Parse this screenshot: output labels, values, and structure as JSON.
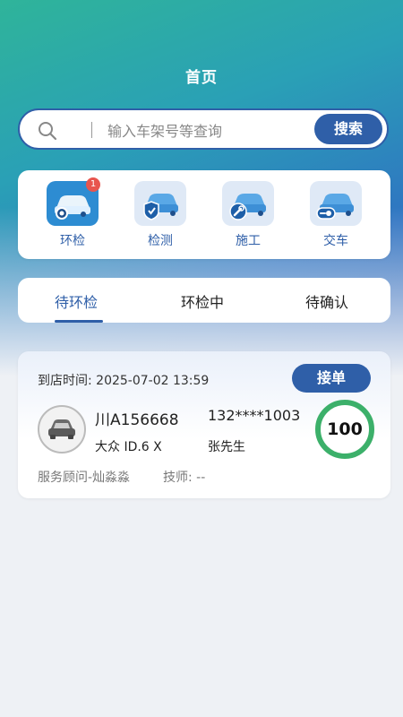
{
  "header": {
    "title": "首页"
  },
  "search": {
    "placeholder": "输入车架号等查询",
    "button_label": "搜索"
  },
  "quick_actions": [
    {
      "label": "环检",
      "badge": "1",
      "icon": "car-inspection-icon"
    },
    {
      "label": "检测",
      "icon": "car-shield-icon"
    },
    {
      "label": "施工",
      "icon": "car-wrench-icon"
    },
    {
      "label": "交车",
      "icon": "car-handover-icon"
    }
  ],
  "tabs": [
    {
      "label": "待环检",
      "active": true
    },
    {
      "label": "环检中",
      "active": false
    },
    {
      "label": "待确认",
      "active": false
    }
  ],
  "order_card": {
    "arrival_time": "到店时间: 2025-07-02 13:59",
    "accept_label": "接单",
    "plate": "川A156668",
    "phone": "132****1003",
    "model": "大众 ID.6 X",
    "owner": "张先生",
    "score": "100",
    "advisor": "服务顾问-灿淼淼",
    "technician": "技师: --"
  },
  "colors": {
    "accent": "#2f5fa8",
    "badge": "#e8554e",
    "score_ring": "#3cb06a"
  }
}
